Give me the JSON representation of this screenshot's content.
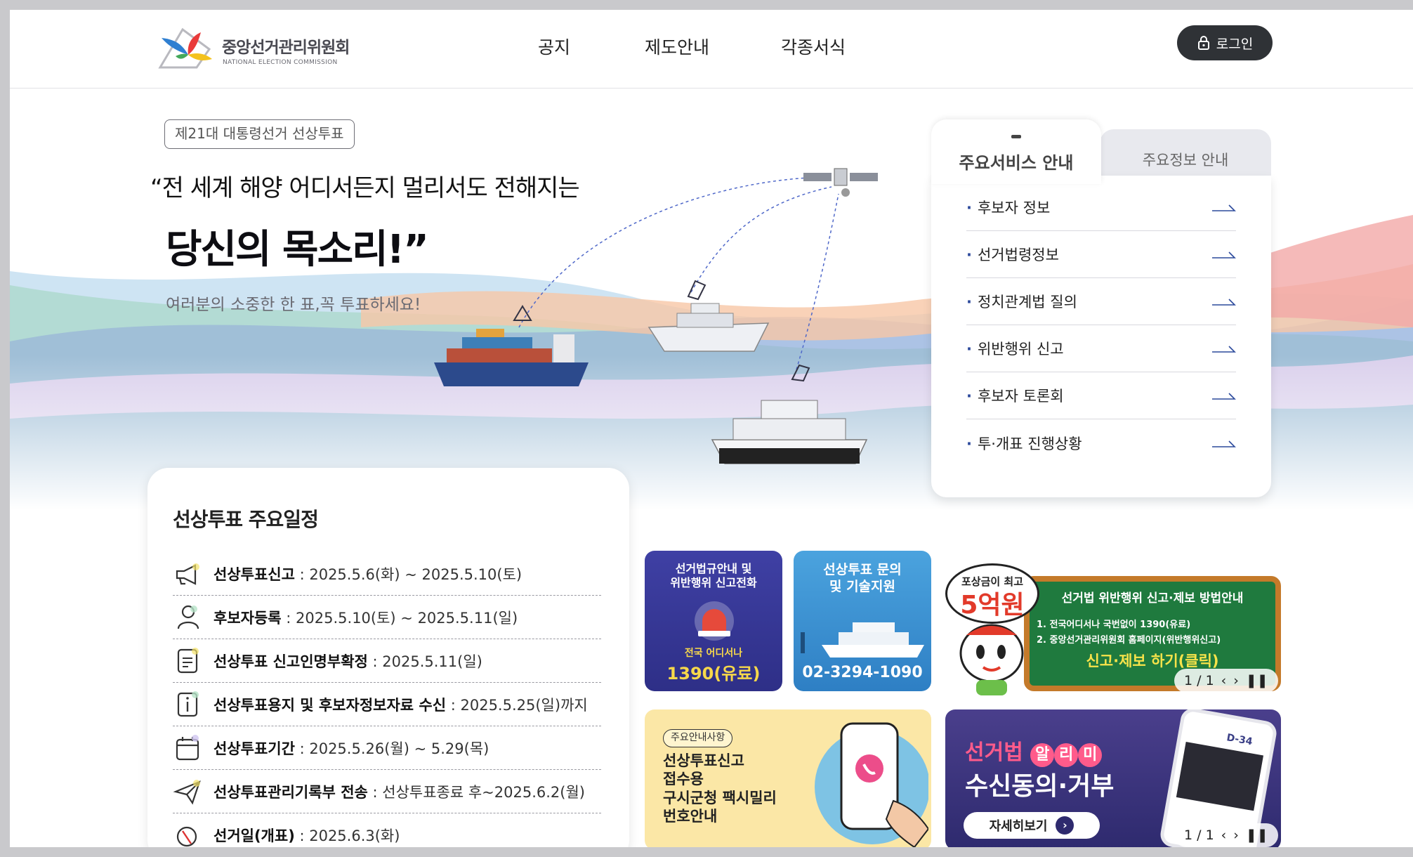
{
  "header": {
    "logo_kr": "중앙선거관리위원회",
    "logo_en": "NATIONAL ELECTION COMMISSION",
    "nav": [
      "공지",
      "제도안내",
      "각종서식"
    ],
    "login_label": "로그인"
  },
  "hero": {
    "badge": "제21대 대통령선거 선상투표",
    "line1": "“전 세계 해양 어디서든지 멀리서도 전해지는",
    "line2": "당신의 목소리!”",
    "line3": "여러분의 소중한 한 표,꼭 투표하세요!"
  },
  "services": {
    "tab_active": "주요서비스 안내",
    "tab_inactive": "주요정보 안내",
    "items": [
      "후보자 정보",
      "선거법령정보",
      "정치관계법 질의",
      "위반행위 신고",
      "후보자 토론회",
      "투·개표 진행상황"
    ]
  },
  "schedule": {
    "title": "선상투표 주요일정",
    "rows": [
      {
        "label": "선상투표신고",
        "value": " : 2025.5.6(화) ~ 2025.5.10(토)",
        "icon": "megaphone-icon"
      },
      {
        "label": "후보자등록",
        "value": " : 2025.5.10(토) ~ 2025.5.11(일)",
        "icon": "person-icon"
      },
      {
        "label": "선상투표 신고인명부확정",
        "value": " : 2025.5.11(일)",
        "icon": "document-icon"
      },
      {
        "label": "선상투표용지 및 후보자정보자료 수신",
        "value": " : 2025.5.25(일)까지",
        "icon": "info-icon"
      },
      {
        "label": "선상투표기간",
        "value": " : 2025.5.26(월) ~ 5.29(목)",
        "icon": "calendar-icon"
      },
      {
        "label": "선상투표관리기록부 전송",
        "value": " : 선상투표종료 후~2025.6.2(월)",
        "icon": "paper-plane-icon"
      },
      {
        "label": "선거일(개표)",
        "value": " : 2025.6.3(화)",
        "icon": "ballot-stamp-icon"
      }
    ]
  },
  "banners": {
    "hotline": {
      "title": "선거법규안내 및\n위반행위 신고전화",
      "sub": "전국 어디서나",
      "number": "1390(유료)"
    },
    "support": {
      "title": "선상투표 문의\n및 기술지원",
      "number": "02-3294-1090"
    },
    "reward": {
      "bubble_top": "포상금이 최고",
      "bubble_amount": "5억원",
      "board_title": "선거법 위반행위 신고·제보 방법안내",
      "board_line1": "1. 전국어디서나 국번없이 1390(유료)",
      "board_line2": "2. 중앙선거관리위원회 홈페이지(위반행위신고)",
      "board_cta": "신고·제보 하기(클릭)",
      "pager": "1 / 1"
    },
    "fax": {
      "tag": "주요안내사항",
      "lines": [
        "선상투표신고",
        "접수용",
        "구시군청 팩시밀리",
        "번호안내"
      ]
    },
    "alimi": {
      "title_a": "선거법",
      "title_chars": [
        "알",
        "리",
        "미"
      ],
      "title_b": "수신동의·거부",
      "cta": "자세히보기",
      "phone_dday": "D-34",
      "pager": "1 / 1"
    }
  },
  "colors": {
    "accent": "#2c4a9c",
    "login_bg": "#2f3236",
    "hotline_bg": "#3d3e9e",
    "support_bg": "#3a8fcf",
    "alimi_bg": "#3a3f86"
  }
}
